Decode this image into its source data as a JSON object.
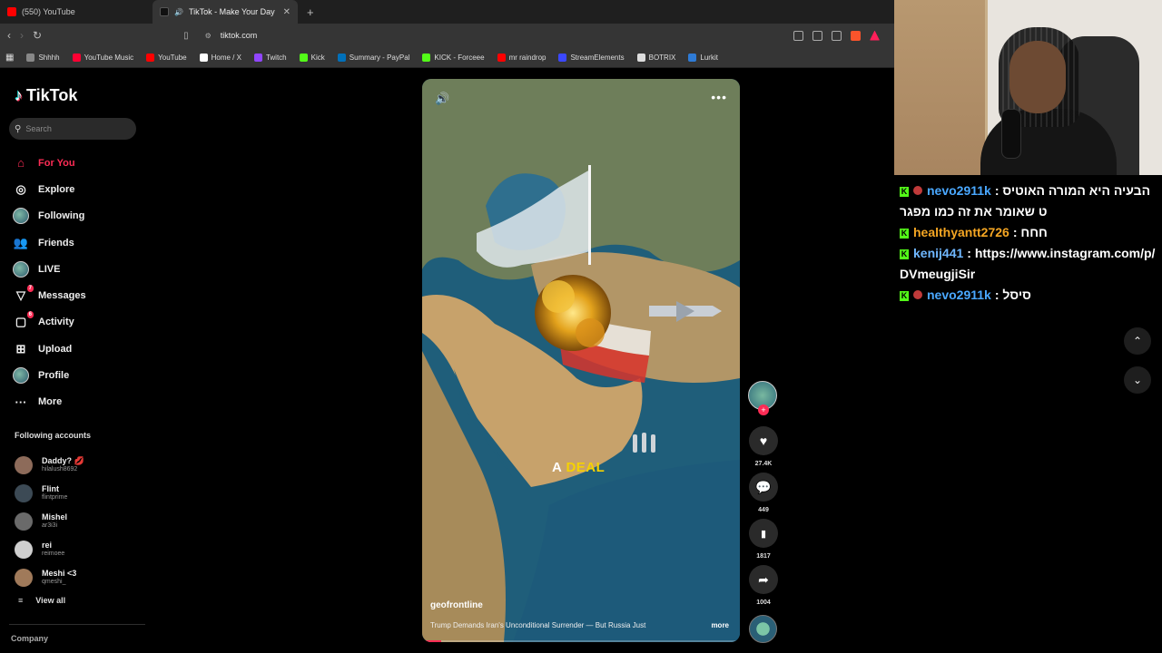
{
  "browser": {
    "tabs": [
      {
        "title": "(550) YouTube",
        "active": false,
        "favicon_color": "#ff0000"
      },
      {
        "title": "TikTok - Make Your Day",
        "active": true,
        "favicon_color": "#111111"
      }
    ],
    "address": "tiktok.com",
    "bookmarks": [
      {
        "label": "Shhhh",
        "icon_color": "#888888"
      },
      {
        "label": "YouTube Music",
        "icon_color": "#ff0033"
      },
      {
        "label": "YouTube",
        "icon_color": "#ff0000"
      },
      {
        "label": "Home / X",
        "icon_color": "#ffffff"
      },
      {
        "label": "Twitch",
        "icon_color": "#9146ff"
      },
      {
        "label": "Kick",
        "icon_color": "#53fc18"
      },
      {
        "label": "Summary - PayPal",
        "icon_color": "#0070ba"
      },
      {
        "label": "KICK - Forceee",
        "icon_color": "#53fc18"
      },
      {
        "label": "mr raindrop",
        "icon_color": "#ff0000"
      },
      {
        "label": "StreamElements",
        "icon_color": "#3b48ff"
      },
      {
        "label": "BOTRIX",
        "icon_color": "#dddddd"
      },
      {
        "label": "Lurkit",
        "icon_color": "#2e7bd6"
      }
    ]
  },
  "tiktok": {
    "brand": "TikTok",
    "search_placeholder": "Search",
    "nav": [
      {
        "label": "For You",
        "icon": "home-icon",
        "active": true
      },
      {
        "label": "Explore",
        "icon": "compass-icon"
      },
      {
        "label": "Following",
        "icon": "following-avatar-icon"
      },
      {
        "label": "Friends",
        "icon": "friends-icon"
      },
      {
        "label": "LIVE",
        "icon": "live-avatar-icon"
      },
      {
        "label": "Messages",
        "icon": "messages-icon",
        "badge": "7"
      },
      {
        "label": "Activity",
        "icon": "activity-icon",
        "badge": "6"
      },
      {
        "label": "Upload",
        "icon": "upload-icon"
      },
      {
        "label": "Profile",
        "icon": "profile-avatar-icon"
      },
      {
        "label": "More",
        "icon": "more-icon"
      }
    ],
    "following_title": "Following accounts",
    "following": [
      {
        "name": "Daddy? 💋",
        "handle": "hilalush8692"
      },
      {
        "name": "Flint",
        "handle": "flintprime"
      },
      {
        "name": "Mishel",
        "handle": "ar3i3i"
      },
      {
        "name": "rei",
        "handle": "reimoee"
      },
      {
        "name": "Meshi <3",
        "handle": "qmeshi_"
      }
    ],
    "view_all": "View all",
    "company": "Company",
    "video": {
      "overlay_word1": "A",
      "overlay_word2": "DEAL",
      "author": "geofrontline",
      "caption": "Trump Demands Iran's Unconditional Surrender — But Russia Just",
      "more": "more",
      "progress": 0.06
    },
    "actions": {
      "likes": "27.4K",
      "comments": "449",
      "saves": "1817",
      "shares": "1004"
    },
    "accent": "#fe2c55"
  },
  "chat": {
    "messages": [
      {
        "user": "nevo2911k",
        "user_color": "#4aa8ff",
        "sub": true,
        "text": "הבעיה היא המורה האוטיסט שאומר את זה כמו מפגר",
        "rtl": true
      },
      {
        "user": "healthyantt2726",
        "user_color": "#f5a623",
        "sub": false,
        "text": "חחח",
        "rtl": true
      },
      {
        "user": "kenij441",
        "user_color": "#6fb7ff",
        "sub": false,
        "text": "https://www.instagram.com/p/DVmeugjiSir",
        "rtl": false
      },
      {
        "user": "nevo2911k",
        "user_color": "#4aa8ff",
        "sub": true,
        "text": "סיסל",
        "rtl": true
      }
    ]
  }
}
